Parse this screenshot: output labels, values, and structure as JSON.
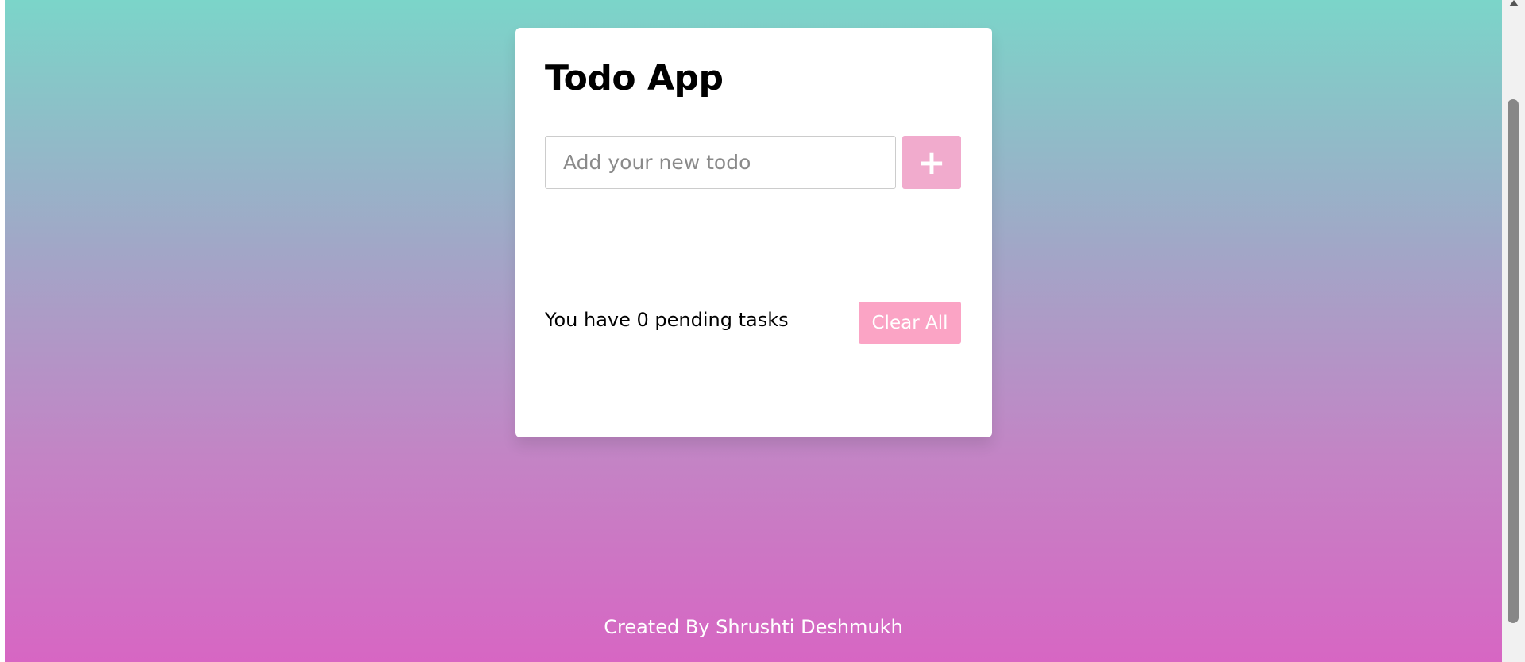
{
  "app": {
    "title": "Todo App"
  },
  "input": {
    "placeholder": "Add your new todo",
    "value": ""
  },
  "add_button": {
    "label": "+",
    "icon": "plus-icon",
    "color": "#f1abcd"
  },
  "status": {
    "pending_text": "You have 0 pending tasks"
  },
  "clear_button": {
    "label": "Clear All",
    "color": "#fba4c5"
  },
  "footer": {
    "text": "Created By Shrushti Deshmukh"
  },
  "colors": {
    "gradient_top": "#7bd5c9",
    "gradient_bottom": "#d766c3"
  }
}
